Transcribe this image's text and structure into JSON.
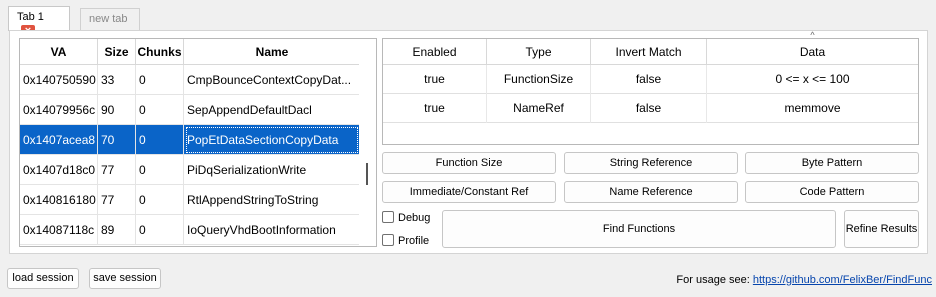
{
  "tabs": [
    {
      "label": "Tab 1",
      "close_glyph": "×"
    },
    {
      "label": "new tab"
    }
  ],
  "functions_table": {
    "columns": [
      "VA",
      "Size",
      "Chunks",
      "Name"
    ],
    "rows": [
      {
        "va": "0x140750590",
        "size": "33",
        "chunks": "0",
        "name": "CmpBounceContextCopyDat..."
      },
      {
        "va": "0x14079956c",
        "size": "90",
        "chunks": "0",
        "name": "SepAppendDefaultDacl"
      },
      {
        "va": "0x1407acea8",
        "size": "70",
        "chunks": "0",
        "name": "PopEtDataSectionCopyData"
      },
      {
        "va": "0x1407d18c0",
        "size": "77",
        "chunks": "0",
        "name": "PiDqSerializationWrite"
      },
      {
        "va": "0x140816180",
        "size": "77",
        "chunks": "0",
        "name": "RtlAppendStringToString"
      },
      {
        "va": "0x14087118c",
        "size": "89",
        "chunks": "0",
        "name": "IoQueryVhdBootInformation"
      }
    ]
  },
  "filters_table": {
    "columns": [
      "Enabled",
      "Type",
      "Invert Match",
      "Data"
    ],
    "rows": [
      {
        "enabled": "true",
        "type": "FunctionSize",
        "invert": "false",
        "data": "0 <= x <= 100"
      },
      {
        "enabled": "true",
        "type": "NameRef",
        "invert": "false",
        "data": "memmove"
      }
    ]
  },
  "buttons": {
    "function_size": "Function Size",
    "string_reference": "String Reference",
    "byte_pattern": "Byte Pattern",
    "immediate_ref": "Immediate/Constant Ref",
    "name_reference": "Name Reference",
    "code_pattern": "Code Pattern",
    "find_functions": "Find Functions",
    "refine_results": "Refine Results",
    "load_session": "load session",
    "save_session": "save session"
  },
  "checkboxes": {
    "debug": "Debug",
    "profile": "Profile"
  },
  "footer": {
    "usage_text": "For usage see: ",
    "link": "https://github.com/FelixBer/FindFunc"
  },
  "colors": {
    "selection": "#0a64c8",
    "link": "#0645ad",
    "close_button": "#e0533f"
  }
}
